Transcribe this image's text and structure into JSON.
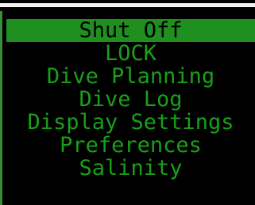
{
  "menu": {
    "items": [
      {
        "label": "Shut Off",
        "selected": true
      },
      {
        "label": "LOCK",
        "selected": false
      },
      {
        "label": "Dive Planning",
        "selected": false
      },
      {
        "label": "Dive Log",
        "selected": false
      },
      {
        "label": "Display Settings",
        "selected": false
      },
      {
        "label": "Preferences",
        "selected": false
      },
      {
        "label": "Salinity",
        "selected": false
      }
    ]
  },
  "colors": {
    "background": "#000000",
    "text": "#19a019",
    "highlight": "#1f8f1f",
    "highlight_text": "#000000",
    "top_bar": "#f2f2f2"
  }
}
